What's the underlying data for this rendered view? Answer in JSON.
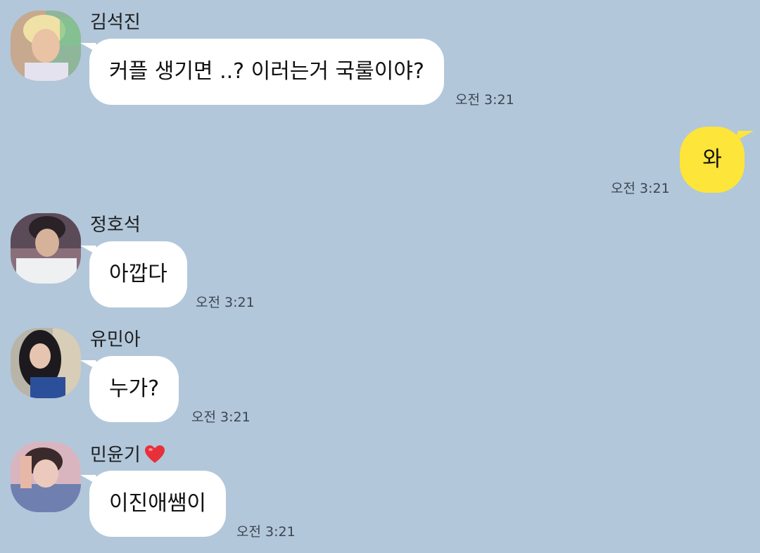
{
  "messages": [
    {
      "sender": "김석진",
      "text": "커플 생기면 ..? 이러는거 국룰이야?",
      "time": "오전 3:21",
      "avatar": "avatar-blonde-icon"
    },
    {
      "sender": "",
      "text": "와",
      "time": "오전 3:21",
      "outgoing": true
    },
    {
      "sender": "정호석",
      "text": "아깝다",
      "time": "오전 3:21",
      "avatar": "avatar-dark-hair-icon"
    },
    {
      "sender": "유민아",
      "text": "누가?",
      "time": "오전 3:21",
      "avatar": "avatar-long-hair-icon"
    },
    {
      "sender": "민윤기",
      "text": "이진애쌤이",
      "time": "오전 3:21",
      "avatar": "avatar-pink-icon",
      "badge": "heart-icon"
    }
  ],
  "colors": {
    "background": "#b2c7da",
    "incoming_bubble": "#ffffff",
    "outgoing_bubble": "#fee53a",
    "heart": "#e8303a"
  }
}
